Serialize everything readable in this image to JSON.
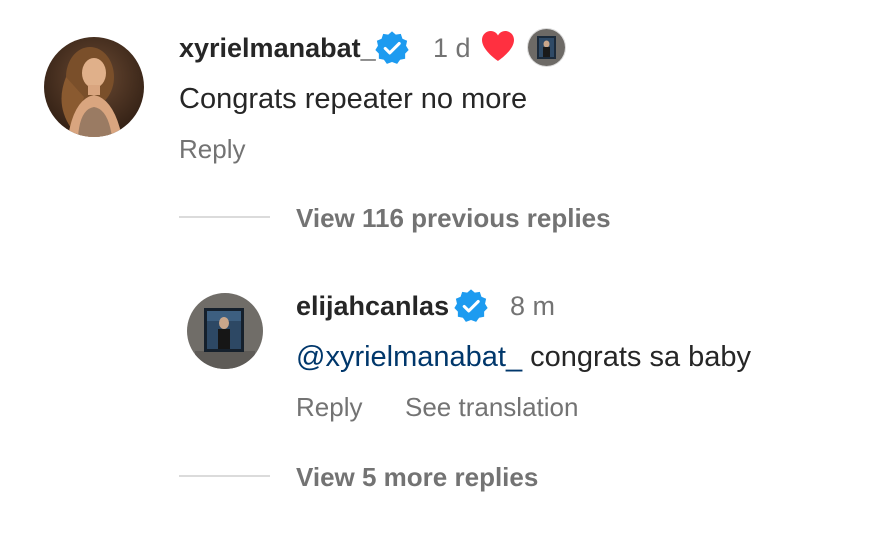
{
  "comment": {
    "username": "xyrielmanabat_",
    "time": "1 d",
    "text": "Congrats repeater no more",
    "reply_label": "Reply"
  },
  "view_previous_replies": "View 116 previous replies",
  "reply": {
    "username": "elijahcanlas",
    "time": "8 m",
    "mention": "@xyrielmanabat_",
    "text": " congrats sa baby",
    "reply_label": "Reply",
    "translate_label": "See translation"
  },
  "view_more_replies": "View 5 more replies",
  "colors": {
    "verified": "#1d9bf0",
    "heart": "#ff3040",
    "secondary_text": "#737373",
    "mention": "#00376b"
  }
}
